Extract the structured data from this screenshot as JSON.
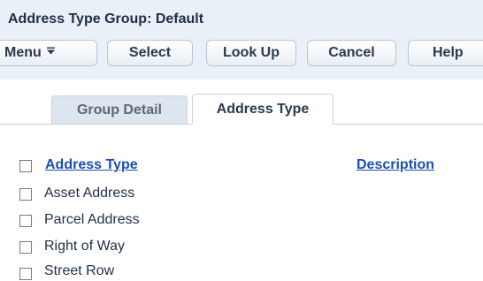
{
  "header": {
    "title": "Address Type Group: Default"
  },
  "toolbar": {
    "menu_label": "Menu",
    "select_label": "Select",
    "lookup_label": "Look Up",
    "cancel_label": "Cancel",
    "help_label": "Help",
    "menu_icon": "menu-caret-icon"
  },
  "tabs": [
    {
      "label": "Group Detail",
      "active": false
    },
    {
      "label": "Address Type",
      "active": true
    }
  ],
  "table": {
    "columns": [
      "Address Type",
      "Description"
    ],
    "rows": [
      {
        "address_type": "Asset Address",
        "description": ""
      },
      {
        "address_type": "Parcel Address",
        "description": ""
      },
      {
        "address_type": "Right of Way",
        "description": ""
      },
      {
        "address_type": "Street Row",
        "description": ""
      }
    ]
  },
  "colors": {
    "title_bar_bg": "#eaf0f7",
    "link_color": "#1a4fb0",
    "text_color": "#1f2f45"
  }
}
